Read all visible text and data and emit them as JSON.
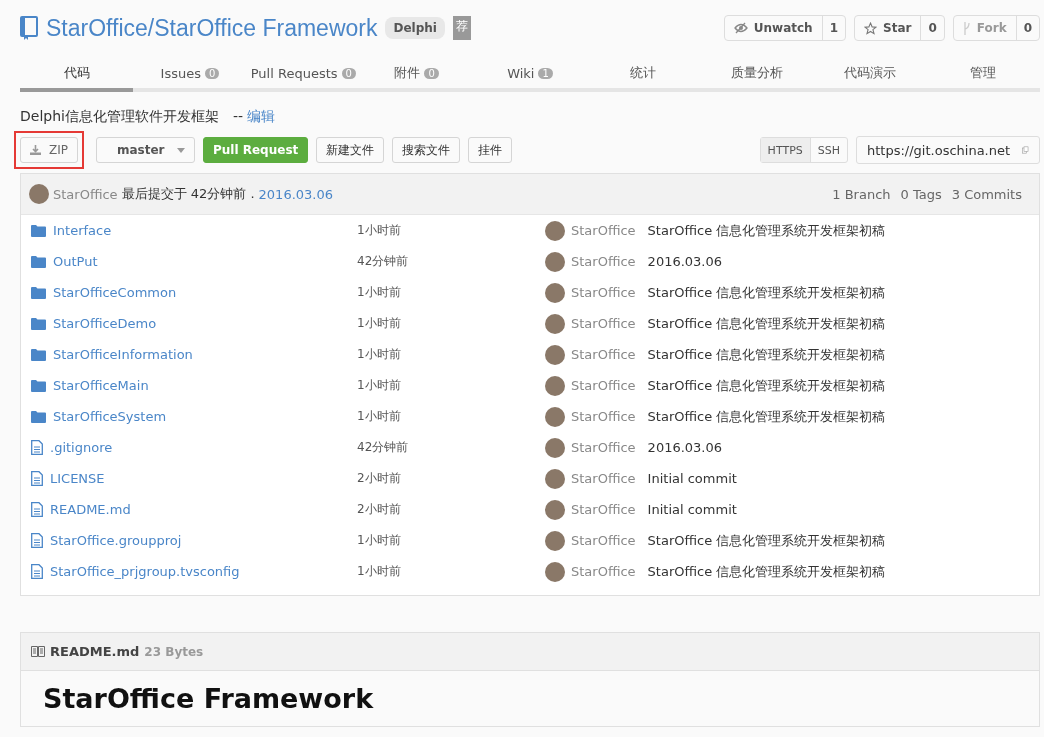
{
  "repo": {
    "owner": "StarOffice",
    "name": "StarOffice Framework",
    "separator": "/",
    "language": "Delphi",
    "badge": "荐"
  },
  "actions": [
    {
      "label": "Unwatch",
      "count": "1",
      "disabled": false,
      "kind": "watch"
    },
    {
      "label": "Star",
      "count": "0",
      "disabled": false,
      "kind": "star"
    },
    {
      "label": "Fork",
      "count": "0",
      "disabled": true,
      "kind": "fork"
    }
  ],
  "tabs": [
    {
      "label": "代码",
      "selected": true
    },
    {
      "label": "Issues",
      "count": "0",
      "selected": false
    },
    {
      "label": "Pull Requests",
      "count": "0",
      "selected": false
    },
    {
      "label": "附件",
      "count": "0",
      "selected": false
    },
    {
      "label": "Wiki",
      "count": "1",
      "selected": false
    },
    {
      "label": "统计",
      "selected": false
    },
    {
      "label": "质量分析",
      "selected": false
    },
    {
      "label": "代码演示",
      "selected": false
    },
    {
      "label": "管理",
      "selected": false
    }
  ],
  "description": {
    "text": "Delphi信息化管理软件开发框架",
    "separator": "--",
    "edit_link": "编辑"
  },
  "toolbar": {
    "zip": {
      "label": "ZIP",
      "highlighted": true
    },
    "branch": "master",
    "pull_request": "Pull Request",
    "buttons": [
      "新建文件",
      "搜索文件",
      "挂件"
    ],
    "protocols": [
      {
        "label": "HTTPS",
        "selected": true
      },
      {
        "label": "SSH",
        "selected": false
      }
    ],
    "clone_url": "https://git.oschina.net"
  },
  "last_commit": {
    "author": "StarOffice",
    "text": "最后提交于 42分钟前 .",
    "date": "2016.03.06",
    "branches": "1 Branch",
    "tags": "0 Tags",
    "commits": "3 Commits"
  },
  "files": [
    {
      "kind": "folder",
      "name": "Interface",
      "time": "1小时前",
      "author": "StarOffice",
      "message": "StarOffice 信息化管理系统开发框架初稿"
    },
    {
      "kind": "folder",
      "name": "OutPut",
      "time": "42分钟前",
      "author": "StarOffice",
      "message": "2016.03.06"
    },
    {
      "kind": "folder",
      "name": "StarOfficeCommon",
      "time": "1小时前",
      "author": "StarOffice",
      "message": "StarOffice 信息化管理系统开发框架初稿"
    },
    {
      "kind": "folder",
      "name": "StarOfficeDemo",
      "time": "1小时前",
      "author": "StarOffice",
      "message": "StarOffice 信息化管理系统开发框架初稿"
    },
    {
      "kind": "folder",
      "name": "StarOfficeInformation",
      "time": "1小时前",
      "author": "StarOffice",
      "message": "StarOffice 信息化管理系统开发框架初稿"
    },
    {
      "kind": "folder",
      "name": "StarOfficeMain",
      "time": "1小时前",
      "author": "StarOffice",
      "message": "StarOffice 信息化管理系统开发框架初稿"
    },
    {
      "kind": "folder",
      "name": "StarOfficeSystem",
      "time": "1小时前",
      "author": "StarOffice",
      "message": "StarOffice 信息化管理系统开发框架初稿"
    },
    {
      "kind": "file",
      "name": ".gitignore",
      "time": "42分钟前",
      "author": "StarOffice",
      "message": "2016.03.06"
    },
    {
      "kind": "file",
      "name": "LICENSE",
      "time": "2小时前",
      "author": "StarOffice",
      "message": "Initial commit"
    },
    {
      "kind": "file",
      "name": "README.md",
      "time": "2小时前",
      "author": "StarOffice",
      "message": "Initial commit"
    },
    {
      "kind": "file",
      "name": "StarOffice.groupproj",
      "time": "1小时前",
      "author": "StarOffice",
      "message": "StarOffice 信息化管理系统开发框架初稿"
    },
    {
      "kind": "file",
      "name": "StarOffice_prjgroup.tvsconfig",
      "time": "1小时前",
      "author": "StarOffice",
      "message": "StarOffice 信息化管理系统开发框架初稿"
    }
  ],
  "readme": {
    "filename": "README.md",
    "size": "23 Bytes",
    "heading": "StarOffice Framework"
  }
}
